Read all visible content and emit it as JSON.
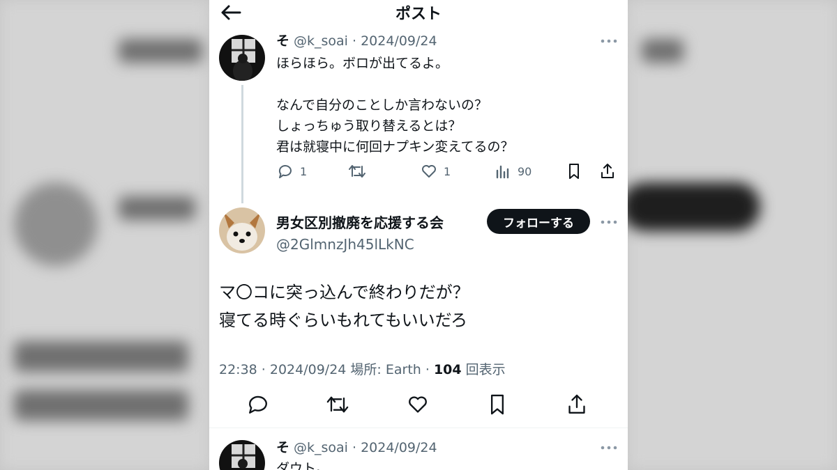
{
  "header": {
    "title": "ポスト"
  },
  "reply1": {
    "name": "そ",
    "meta": "@k_soai · 2024/09/24",
    "body": "ほらほら。ボロが出てるよ。\n\nなんで自分のことしか言わないの？\nしょっちゅう取り替えるとは？\n君は就寝中に何回ナプキン変えてるの？",
    "replies": "1",
    "likes": "1",
    "views": "90"
  },
  "main": {
    "name": "男女区別撤廃を応援する会",
    "handle": "@2GlmnzJh45lLkNC",
    "follow_label": "フォローする",
    "text": "マ〇コに突っ込んで終わりだが？\n寝てる時ぐらいもれてもいいだろ",
    "time": "22:38 · 2024/09/24 場所: Earth · ",
    "views_count": "104",
    "views_label": " 回表示"
  },
  "reply2": {
    "name": "そ",
    "meta": "@k_soai · 2024/09/24",
    "body": "ダウト。"
  },
  "colors": {
    "accent_text": "#0f1419",
    "muted": "#536471",
    "follow_bg": "#0f1419"
  }
}
